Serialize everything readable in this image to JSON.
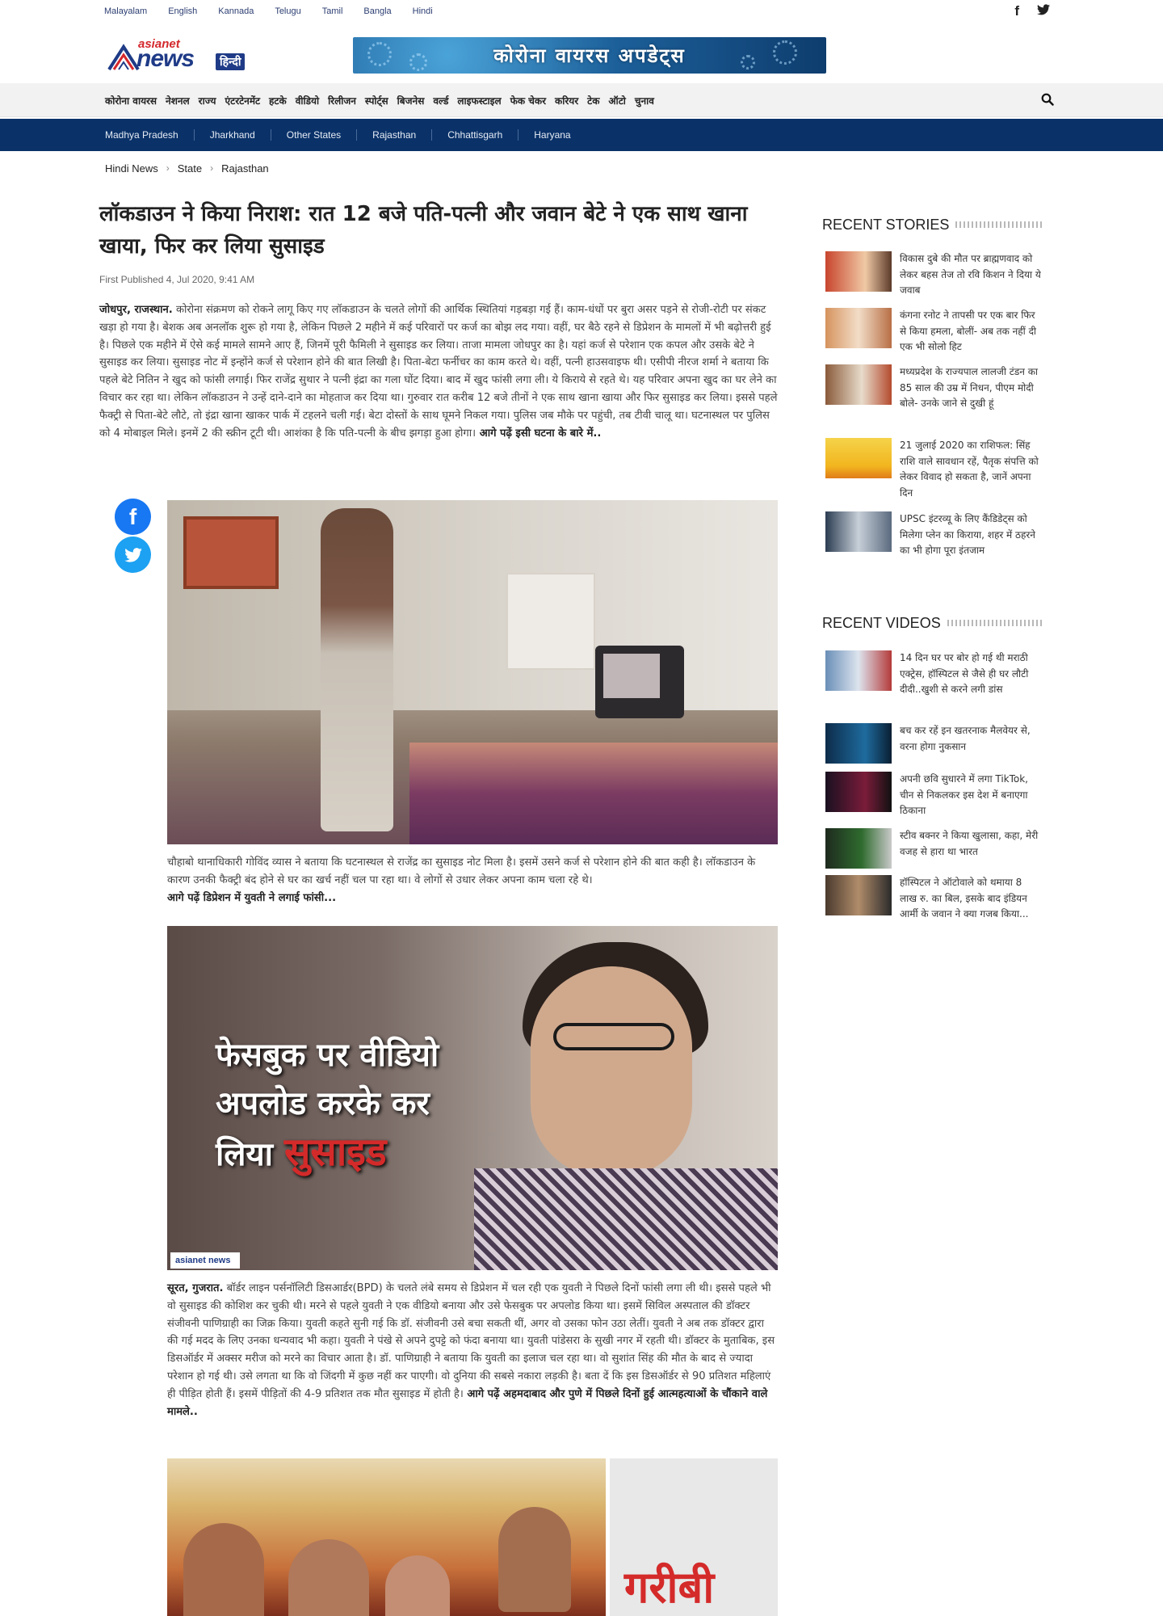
{
  "languages": [
    "Malayalam",
    "English",
    "Kannada",
    "Telugu",
    "Tamil",
    "Bangla",
    "Hindi"
  ],
  "social": {
    "facebook": "f",
    "twitter": "t"
  },
  "logo": {
    "brand": "asianet",
    "name": "news",
    "lang": "हिन्दी"
  },
  "banner": {
    "text": "कोरोना वायरस अपडेट्स"
  },
  "main_nav": [
    "कोरोना वायरस",
    "नेशनल",
    "राज्य",
    "एंटरटेनमेंट",
    "हटके",
    "वीडियो",
    "रिलीजन",
    "स्पोर्ट्स",
    "बिजनेस",
    "वर्ल्ड",
    "लाइफस्टाइल",
    "फेक चेकर",
    "करियर",
    "टेक",
    "ऑटो",
    "चुनाव"
  ],
  "sub_nav": [
    "Madhya Pradesh",
    "Jharkhand",
    "Other States",
    "Rajasthan",
    "Chhattisgarh",
    "Haryana"
  ],
  "breadcrumb": [
    "Hindi News",
    "State",
    "Rajasthan"
  ],
  "article": {
    "title": "लॉकडाउन ने किया निराश: रात 12 बजे पति-पत्नी और जवान बेटे ने एक साथ खाना खाया, फिर कर लिया सुसाइड",
    "published": "First Published 4, Jul 2020, 9:41 AM",
    "intro_lead": "जोधपुर, राजस्थान.",
    "intro_body": " कोरोना संक्रमण को रोकने लागू किए गए लॉकडाउन के चलते लोगों की आर्थिक स्थितियां गड़बड़ा गई हैं। काम-धंधों पर बुरा असर पड़ने से रोजी-रोटी पर संकट खड़ा हो गया है। बेशक अब अनलॉक शुरू हो गया है, लेकिन पिछले 2 महीने में कई परिवारों पर कर्ज का बोझ लद गया। वहीं, घर बैठे रहने से डिप्रेशन के मामलों में भी बढ़ोत्तरी हुई है। पिछले एक महीने में ऐसे कई मामले सामने आए हैं, जिनमें पूरी फैमिली ने सुसाइड कर लिया। ताजा मामला जोधपुर का है। यहां कर्ज से परेशान एक कपल और उसके बेटे ने सुसाइड कर लिया। सुसाइड नोट में इन्होंने कर्ज से परेशान होने की बात लिखी है। पिता-बेटा फर्नीचर का काम करते थे। वहीं, पत्नी हाउसवाइफ थी। एसीपी नीरज शर्मा ने बताया कि पहले बेटे नितिन ने खुद को फांसी लगाई। फिर राजेंद्र सुथार ने पत्नी इंद्रा का गला घोंट दिया। बाद में खुद फांसी लगा ली। ये किराये से रहते थे। यह परिवार अपना खुद का घर लेने का विचार कर रहा था। लेकिन लॉकडाउन ने उन्हें दाने-दाने का मोहताज कर दिया था। गुरुवार रात करीब 12 बजे तीनों ने एक साथ खाना खाया और फिर सुसाइड कर लिया। इससे पहले फैक्ट्री से पिता-बेटे लौटे, तो इंद्रा खाना खाकर पार्क में टहलने चली गई। बेटा दोस्तों के साथ घूमने निकल गया। पुलिस जब मौके पर पहुंची, तब टीवी चालू था। घटनास्थल पर पुलिस को 4 मोबाइल मिले। इनमें 2 की स्क्रीन टूटी थी। आशंका है कि पति-पत्नी के बीच झगड़ा हुआ होगा।",
    "intro_more": " आगे पढ़ें इसी घटना के बारे में..",
    "caption1_body": "चौहाबो थानाधिकारी गोविंद व्यास ने बताया कि घटनास्थल से राजेंद्र का सुसाइड नोट मिला है। इसमें उसने कर्ज से परेशान होने की बात कही है। लॉकडाउन के कारण उनकी फैक्ट्री बंद होने से घर का खर्च नहीं चल पा रहा था। वे लोगों से उधार लेकर अपना काम चला रहे थे।",
    "caption1_more": "आगे पढ़ें डिप्रेशन में युवती ने लगाई फांसी...",
    "image2_overlay_l1": "फेसबुक पर वीडियो",
    "image2_overlay_l2": "अपलोड करके कर",
    "image2_overlay_l3a": "लिया ",
    "image2_overlay_l3b": "सुसाइड",
    "watermark": "asianet news हिन्दी",
    "caption2_lead": "सूरत, गुजरात.",
    "caption2_body": " बॉर्डर लाइन पर्सनॉलिटी डिसआर्डर(BPD) के चलते लंबे समय से डिप्रेशन में चल रही एक युवती ने पिछले दिनों फांसी लगा ली थी। इससे पहले भी वो सुसाइड की कोशिश कर चुकी थी। मरने से पहले युवती ने एक वीडियो बनाया और उसे फेसबुक पर अपलोड किया था। इसमें सिविल अस्पताल की डॉक्टर संजीवनी पाणिग्राही का जिक्र किया। युवती कहते सुनी गई कि डॉ. संजीवनी उसे बचा सकती थीं, अगर वो उसका फोन उठा लेतीं। युवती ने अब तक डॉक्टर द्वारा की गई मदद के लिए उनका धन्यवाद भी कहा। युवती ने पंखे से अपने दुपट्टे को फंदा बनाया था। युवती पांडेसरा के सुखी नगर में रहती थी। डॉक्टर के मुताबिक, इस डिसऑर्डर में अक्सर मरीज को मरने का विचार आता है। डॉ. पाणिग्राही ने बताया कि युवती का इलाज चल रहा था। वो सुशांत सिंह की मौत के बाद से ज्यादा परेशान हो गई थी। उसे लगता था कि वो जिंदगी में कुछ नहीं कर पाएगी। वो दुनिया की सबसे नकारा लड़की है। बता दें कि इस डिसऑर्डर से 90 प्रतिशत महिलाएं ही पीड़ित होती हैं। इसमें पीड़ितों की 4-9 प्रतिशत तक मौत सुसाइड में होती है।",
    "caption2_more": " आगे पढ़ें अहमदाबाद और पुणे में पिछले दिनों हुई आत्महत्याओं के चौंकाने वाले मामले..",
    "image4_text": "गरीबी"
  },
  "sidebar": {
    "recent_stories_title": "RECENT STORIES",
    "recent_stories": [
      "विकास दुबे की मौत पर ब्राह्मणवाद को लेकर बहस तेज तो रवि किशन ने दिया ये जवाब",
      "कंगना रनोट ने तापसी पर एक बार फिर से किया हमला, बोलीं- अब तक नहीं दी एक भी सोलो हिट",
      "मध्यप्रदेश के राज्यपाल लालजी टंडन का 85 साल की उम्र में निधन, पीएम मोदी बोले- उनके जाने से दुखी हूं",
      "21 जुलाई 2020 का राशिफल: सिंह राशि वाले सावधान रहें, पैतृक संपत्ति को लेकर विवाद हो सकता है, जानें अपना दिन",
      "UPSC इंटरव्यू के लिए कैंडिडेट्स को मिलेगा प्लेन का किराया, शहर में ठहरने का भी होगा पूरा इंतजाम"
    ],
    "recent_videos_title": "RECENT VIDEOS",
    "recent_videos": [
      "14 दिन घर पर बोर हो गई थी मराठी एक्ट्रेस, हॉस्पिटल से जैसे ही घर लौटी दीदी..खुशी से करने लगी डांस",
      "बच कर रहें इन खतरनाक मैलवेयर से, वरना होगा नुकसान",
      "अपनी छवि सुधारने में लगा TikTok, चीन से निकलकर इस देश में बनाएगा ठिकाना",
      "स्टीव बक्नर ने किया खुलासा, कहा, मेरी वजह से हारा था भारत",
      "हॉस्पिटल ने ऑटोवाले को थमाया 8 लाख रु. का बिल, इसके बाद इंडियन आर्मी के जवान ने क्या गजब किया..."
    ]
  },
  "colors": {
    "navy": "#0a3269",
    "brand_red": "#d4282d",
    "brand_blue": "#1f3b87",
    "facebook": "#1877f2",
    "twitter": "#1da1f2"
  }
}
